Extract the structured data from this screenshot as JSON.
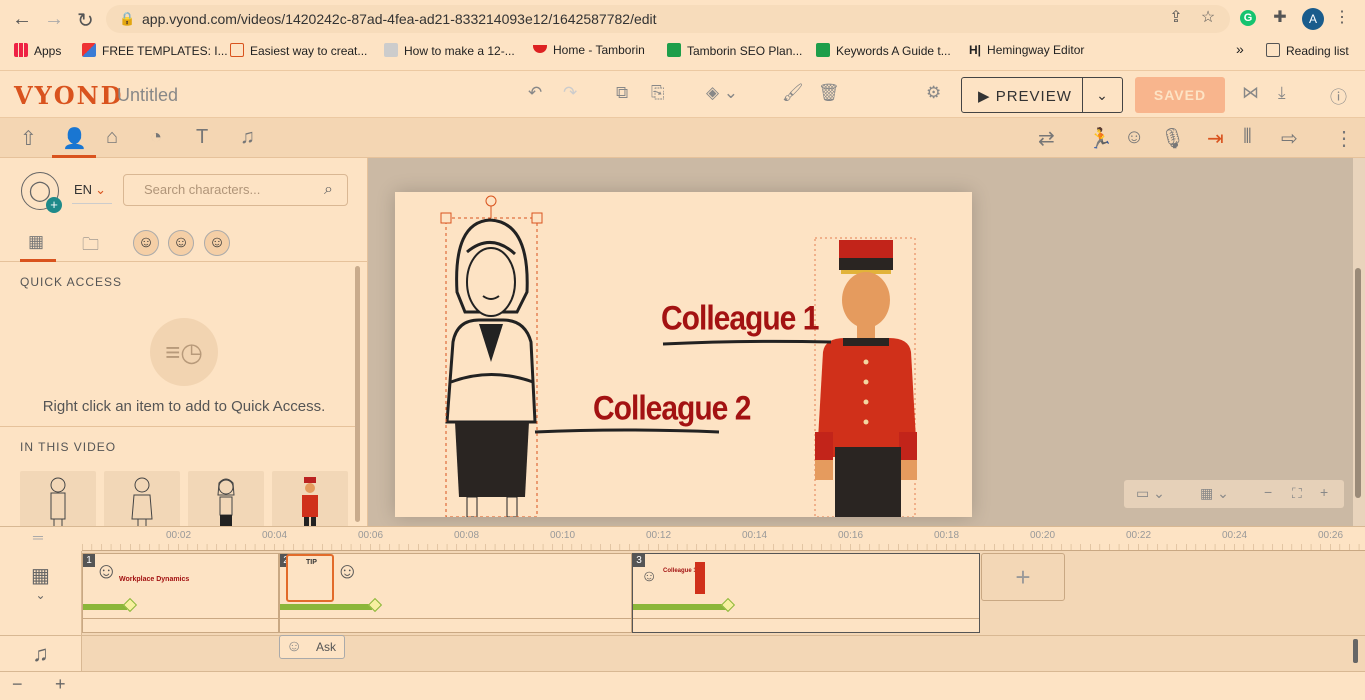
{
  "browser": {
    "url": "app.vyond.com/videos/1420242c-87ad-4fea-ad21-833214093e12/1642587782/edit",
    "profile_initial": "A",
    "bookmarks": [
      "Apps",
      "FREE TEMPLATES: I...",
      "Easiest way to creat...",
      "How to make a 12-...",
      "Home - Tamborin",
      "Tamborin SEO Plan...",
      "Keywords A Guide t...",
      "Hemingway Editor"
    ],
    "reading_list": "Reading list",
    "more": "»"
  },
  "app": {
    "logo": "VYOND",
    "title": "Untitled",
    "preview_label": "PREVIEW",
    "saved_label": "SAVED"
  },
  "left_panel": {
    "lang": "EN",
    "search_placeholder": "Search characters...",
    "quick_access_title": "QUICK ACCESS",
    "quick_access_hint": "Right click an item to add to Quick Access.",
    "in_this_video_title": "IN THIS VIDEO"
  },
  "stage": {
    "caption1": "Colleague 1",
    "caption2": "Colleague 2"
  },
  "timeline": {
    "ticks": [
      "00:02",
      "00:04",
      "00:06",
      "00:08",
      "00:10",
      "00:12",
      "00:14",
      "00:16",
      "00:18",
      "00:20",
      "00:22",
      "00:24",
      "00:26"
    ],
    "scenes": [
      {
        "num": "1",
        "mini_text": "Workplace Dynamics"
      },
      {
        "num": "2",
        "mini_text": "TIP"
      },
      {
        "num": "3",
        "mini_text": "Colleague 1"
      }
    ],
    "audio_clip": "Ask y"
  },
  "colors": {
    "brand": "#d9531e",
    "background": "#fde3c4",
    "caption": "#a31212",
    "scene_bar": "#8bb63a"
  }
}
